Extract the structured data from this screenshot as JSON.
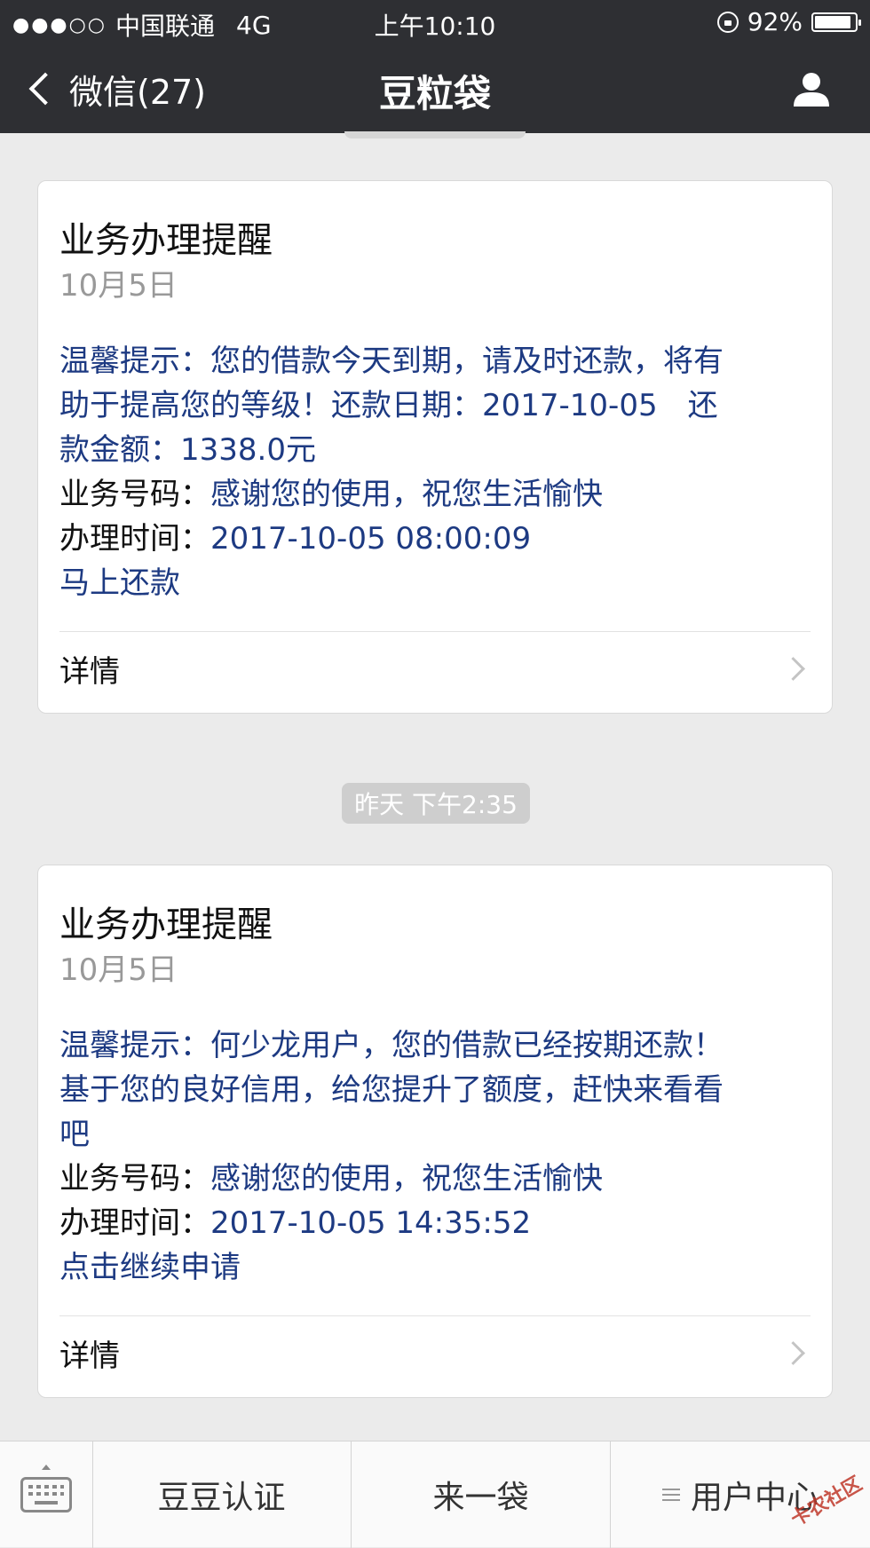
{
  "status_bar": {
    "signal": "●●●○○",
    "carrier": "中国联通",
    "network": "4G",
    "time": "上午10:10",
    "battery_text": "92%",
    "battery_level": 0.92
  },
  "nav": {
    "back_label": "微信(27)",
    "title": "豆粒袋"
  },
  "cards": [
    {
      "title": "业务办理提醒",
      "date": "10月5日",
      "line1": "温馨提示：您的借款今天到期，请及时还款，将有",
      "line2": "助于提高您的等级！还款日期：2017-10-05　还",
      "line3": "款金额：1338.0元",
      "biz_label": "业务号码：",
      "biz_value": "感谢您的使用，祝您生活愉快",
      "time_label": "办理时间：",
      "time_value": "2017-10-05 08:00:09",
      "action": "马上还款",
      "detail": "详情"
    },
    {
      "title": "业务办理提醒",
      "date": "10月5日",
      "line1": "温馨提示：何少龙用户，您的借款已经按期还款！",
      "line2": "基于您的良好信用，给您提升了额度，赶快来看看",
      "line3": "吧",
      "biz_label": "业务号码：",
      "biz_value": "感谢您的使用，祝您生活愉快",
      "time_label": "办理时间：",
      "time_value": "2017-10-05 14:35:52",
      "action": "点击继续申请",
      "detail": "详情"
    }
  ],
  "timestamp": "昨天 下午2:35",
  "bottom_menu": {
    "keyboard_icon": "keyboard-icon",
    "items": [
      "豆豆认证",
      "来一袋",
      "用户中心"
    ]
  },
  "watermark": "卡农社区",
  "colors": {
    "header_bg": "#2e2f33",
    "page_bg": "#ebebeb",
    "link_blue": "#1d3a82"
  }
}
